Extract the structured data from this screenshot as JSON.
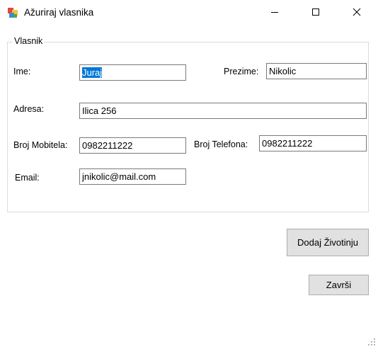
{
  "window": {
    "title": "Ažuriraj vlasnika",
    "controls": {
      "minimize_icon": "minimize-icon",
      "maximize_icon": "maximize-icon",
      "close_icon": "close-icon"
    }
  },
  "group": {
    "title": "Vlasnik",
    "fields": {
      "ime": {
        "label": "Ime:",
        "value": "Juraj"
      },
      "prezime": {
        "label": "Prezime:",
        "value": "Nikolic"
      },
      "adresa": {
        "label": "Adresa:",
        "value": "Ilica 256"
      },
      "broj_mobitela": {
        "label": "Broj Mobitela:",
        "value": "0982211222"
      },
      "broj_telefona": {
        "label": "Broj Telefona:",
        "value": "0982211222"
      },
      "email": {
        "label": "Email:",
        "value": "jnikolic@mail.com"
      }
    }
  },
  "buttons": {
    "dodaj_zivotinju": "Dodaj Životinju",
    "zavrsi": "Završi"
  },
  "colors": {
    "selection": "#0078d7",
    "button_face": "#e1e1e1",
    "border": "#7a7a7a"
  }
}
